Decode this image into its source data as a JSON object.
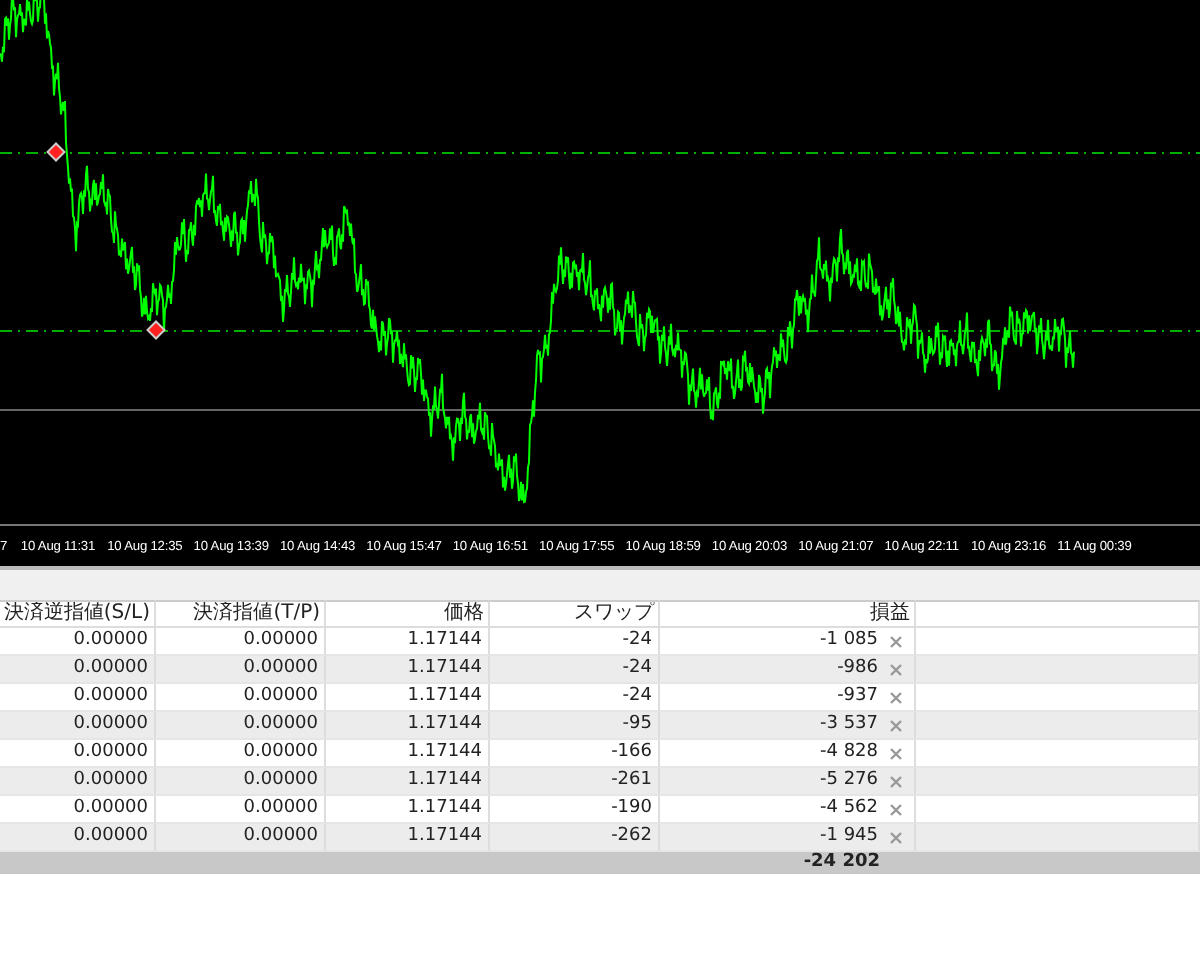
{
  "chart": {
    "time_labels": [
      "7",
      "10 Aug 11:31",
      "10 Aug 12:35",
      "10 Aug 13:39",
      "10 Aug 14:43",
      "10 Aug 15:47",
      "10 Aug 16:51",
      "10 Aug 17:55",
      "10 Aug 18:59",
      "10 Aug 20:03",
      "10 Aug 21:07",
      "10 Aug 22:11",
      "10 Aug 23:16",
      "11 Aug 00:39"
    ]
  },
  "table": {
    "columns": [
      "決済逆指値(S/L)",
      "決済指値(T/P)",
      "価格",
      "スワップ",
      "損益"
    ],
    "rows": [
      {
        "sl": "0.00000",
        "tp": "0.00000",
        "price": "1.17144",
        "swap": "-24",
        "profit": "-1 085"
      },
      {
        "sl": "0.00000",
        "tp": "0.00000",
        "price": "1.17144",
        "swap": "-24",
        "profit": "-986"
      },
      {
        "sl": "0.00000",
        "tp": "0.00000",
        "price": "1.17144",
        "swap": "-24",
        "profit": "-937"
      },
      {
        "sl": "0.00000",
        "tp": "0.00000",
        "price": "1.17144",
        "swap": "-95",
        "profit": "-3 537"
      },
      {
        "sl": "0.00000",
        "tp": "0.00000",
        "price": "1.17144",
        "swap": "-166",
        "profit": "-4 828"
      },
      {
        "sl": "0.00000",
        "tp": "0.00000",
        "price": "1.17144",
        "swap": "-261",
        "profit": "-5 276"
      },
      {
        "sl": "0.00000",
        "tp": "0.00000",
        "price": "1.17144",
        "swap": "-190",
        "profit": "-4 562"
      },
      {
        "sl": "0.00000",
        "tp": "0.00000",
        "price": "1.17144",
        "swap": "-262",
        "profit": "-1 945"
      }
    ],
    "total": "-24 202"
  }
}
